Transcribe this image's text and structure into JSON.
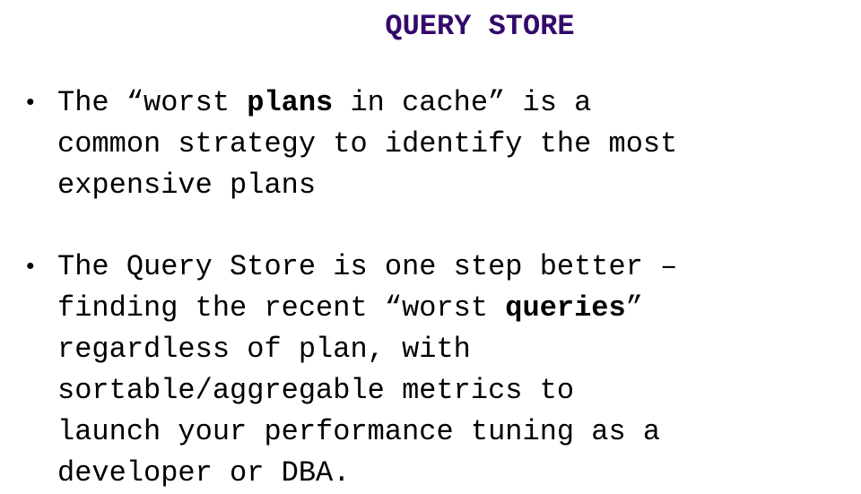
{
  "title": "QUERY STORE",
  "colors": {
    "title": "#330a6b",
    "text": "#000000",
    "background": "#ffffff"
  },
  "bullets": [
    {
      "icon": "bullet-dot-icon",
      "lines": [
        {
          "pre": "The “worst ",
          "bold": "plans",
          "post": " in cache” is a"
        },
        {
          "pre": "common strategy to identify the most",
          "bold": "",
          "post": ""
        },
        {
          "pre": "expensive plans",
          "bold": "",
          "post": ""
        }
      ]
    },
    {
      "icon": "bullet-dot-icon",
      "lines": [
        {
          "pre": "The Query Store is one step better –",
          "bold": "",
          "post": ""
        },
        {
          "pre": "finding the recent “worst ",
          "bold": "queries",
          "post": "”"
        },
        {
          "pre": "regardless of plan, with",
          "bold": "",
          "post": ""
        },
        {
          "pre": "sortable/aggregable metrics to",
          "bold": "",
          "post": ""
        },
        {
          "pre": "launch your performance tuning as a",
          "bold": "",
          "post": ""
        },
        {
          "pre": "developer or DBA.",
          "bold": "",
          "post": ""
        }
      ]
    }
  ]
}
